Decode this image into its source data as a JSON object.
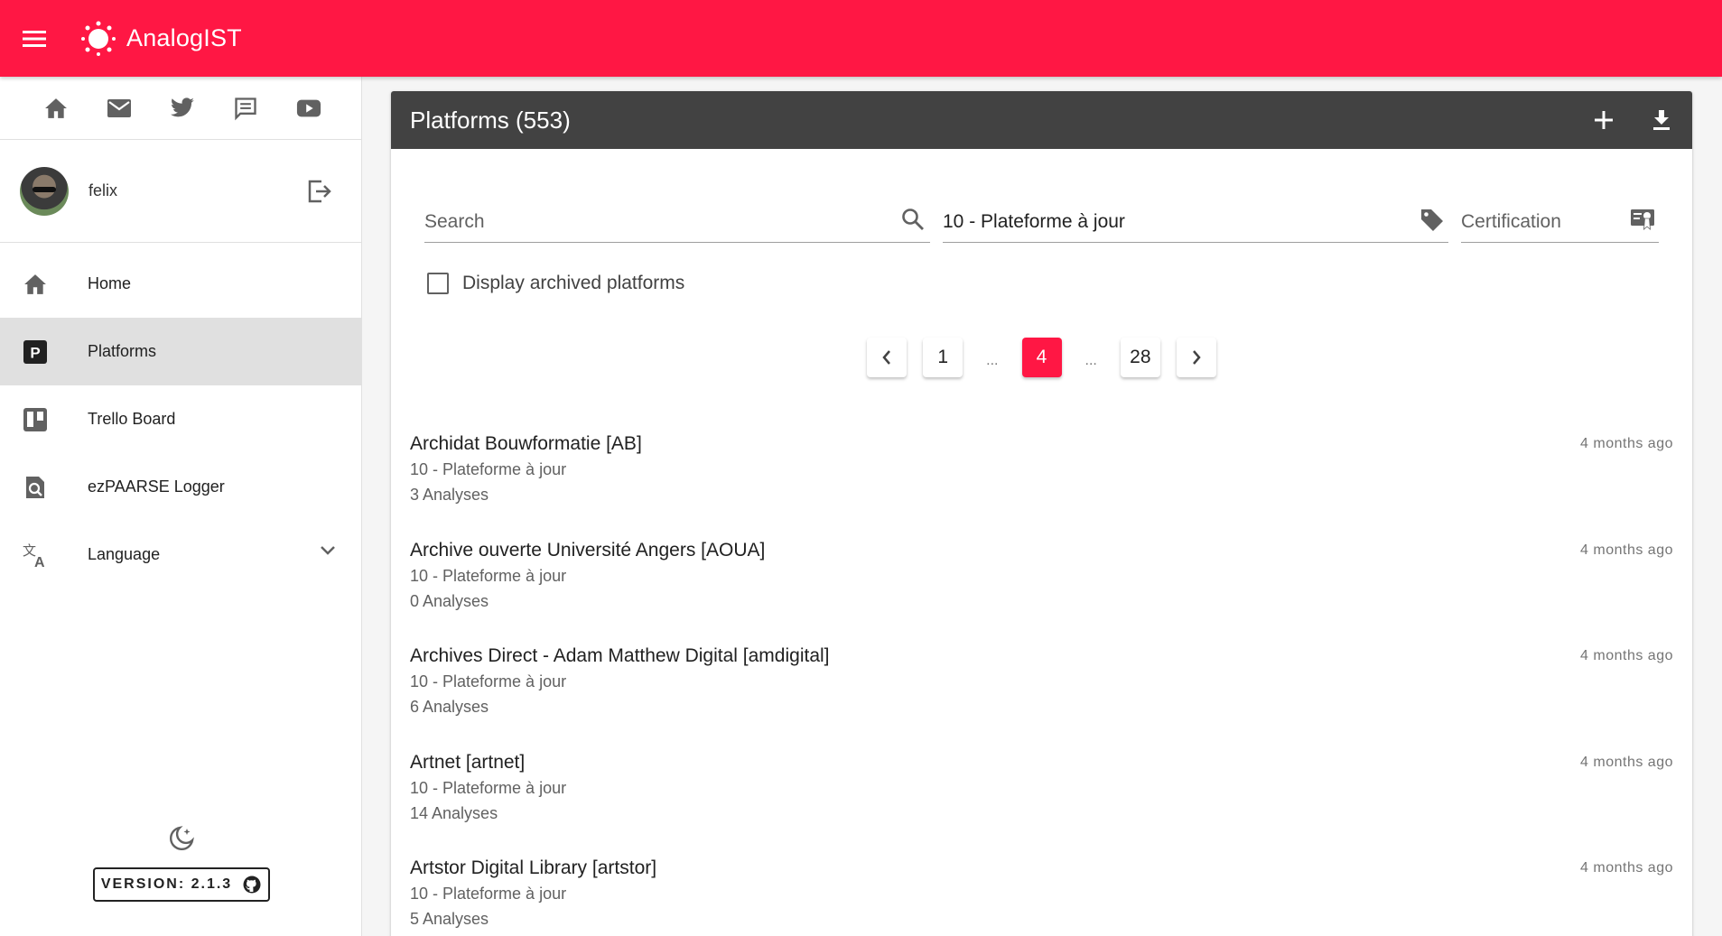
{
  "app": {
    "title": "AnalogIST",
    "brand_color": "#ff1744"
  },
  "sidebar": {
    "social_icons": [
      "home-icon",
      "mail-icon",
      "twitter-icon",
      "chat-icon",
      "youtube-icon"
    ],
    "user": {
      "name": "felix"
    },
    "nav": [
      {
        "label": "Home",
        "icon": "home-icon",
        "active": false
      },
      {
        "label": "Platforms",
        "icon": "platform-p-icon",
        "active": true
      },
      {
        "label": "Trello Board",
        "icon": "trello-icon",
        "active": false
      },
      {
        "label": "ezPAARSE Logger",
        "icon": "log-search-icon",
        "active": false
      },
      {
        "label": "Language",
        "icon": "translate-icon",
        "active": false
      }
    ],
    "version": "VERSION: 2.1.3"
  },
  "main": {
    "title": "Platforms (553)",
    "search": {
      "placeholder": "Search",
      "value": ""
    },
    "tag_filter": {
      "value": "10 - Plateforme à jour"
    },
    "certification": {
      "placeholder": "Certification",
      "value": ""
    },
    "archived_label": "Display archived platforms",
    "pagination": {
      "first": "1",
      "dots_left": "...",
      "current": "4",
      "dots_right": "...",
      "last": "28"
    },
    "platforms": [
      {
        "name": "Archidat Bouwformatie [AB]",
        "status": "10 - Plateforme à jour",
        "analyses": "3 Analyses",
        "updated": "4 months ago"
      },
      {
        "name": "Archive ouverte Université Angers [AOUA]",
        "status": "10 - Plateforme à jour",
        "analyses": "0 Analyses",
        "updated": "4 months ago"
      },
      {
        "name": "Archives Direct - Adam Matthew Digital [amdigital]",
        "status": "10 - Plateforme à jour",
        "analyses": "6 Analyses",
        "updated": "4 months ago"
      },
      {
        "name": "Artnet [artnet]",
        "status": "10 - Plateforme à jour",
        "analyses": "14 Analyses",
        "updated": "4 months ago"
      },
      {
        "name": "Artstor Digital Library [artstor]",
        "status": "10 - Plateforme à jour",
        "analyses": "5 Analyses",
        "updated": "4 months ago"
      }
    ]
  }
}
